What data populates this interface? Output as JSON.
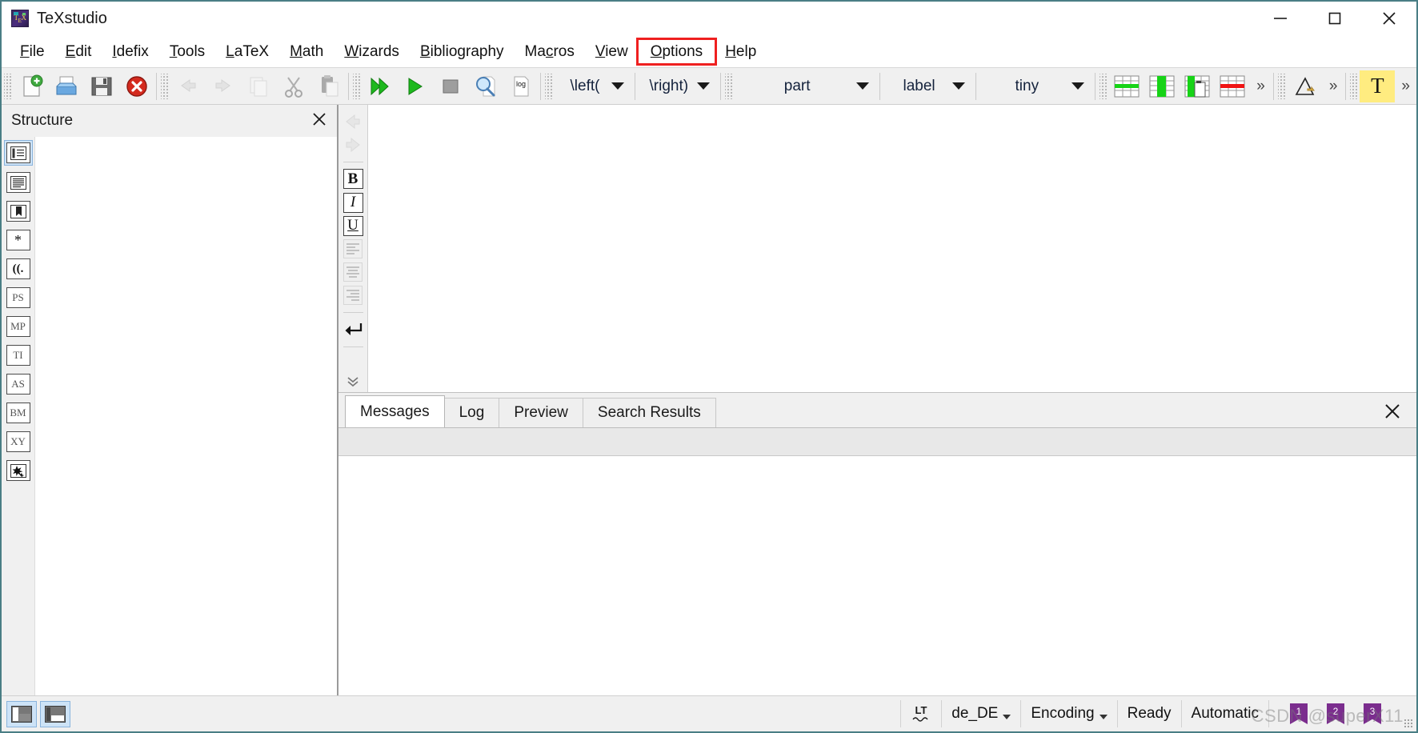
{
  "window": {
    "title": "TeXstudio",
    "icon": "texstudio-app-icon",
    "controls": {
      "minimize": "minimize-button",
      "maximize": "maximize-button",
      "close": "close-button"
    }
  },
  "menubar": {
    "items": [
      {
        "label": "File",
        "accel": "F",
        "highlighted": false
      },
      {
        "label": "Edit",
        "accel": "E",
        "highlighted": false
      },
      {
        "label": "Idefix",
        "accel": "I",
        "highlighted": false
      },
      {
        "label": "Tools",
        "accel": "T",
        "highlighted": false
      },
      {
        "label": "LaTeX",
        "accel": "L",
        "highlighted": false
      },
      {
        "label": "Math",
        "accel": "M",
        "highlighted": false
      },
      {
        "label": "Wizards",
        "accel": "W",
        "highlighted": false
      },
      {
        "label": "Bibliography",
        "accel": "B",
        "highlighted": false
      },
      {
        "label": "Macros",
        "accel": "c",
        "highlighted": false
      },
      {
        "label": "View",
        "accel": "V",
        "highlighted": false
      },
      {
        "label": "Options",
        "accel": "O",
        "highlighted": true
      },
      {
        "label": "Help",
        "accel": "H",
        "highlighted": false
      }
    ],
    "highlight_color": "#ef2020"
  },
  "toolbar": {
    "buttons": [
      {
        "name": "new-document-icon",
        "enabled": true
      },
      {
        "name": "open-document-icon",
        "enabled": true
      },
      {
        "name": "save-document-icon",
        "enabled": true
      },
      {
        "name": "close-document-icon",
        "enabled": true
      },
      {
        "name": "undo-icon",
        "enabled": false
      },
      {
        "name": "redo-icon",
        "enabled": false
      },
      {
        "name": "copy-icon",
        "enabled": false
      },
      {
        "name": "cut-scissors-icon",
        "enabled": false
      },
      {
        "name": "paste-clipboard-icon",
        "enabled": false
      },
      {
        "name": "build-and-view-icon",
        "enabled": true
      },
      {
        "name": "compile-run-icon",
        "enabled": true
      },
      {
        "name": "stop-compile-icon",
        "enabled": true
      },
      {
        "name": "view-pdf-icon",
        "enabled": true
      },
      {
        "name": "view-log-icon",
        "enabled": true
      }
    ],
    "combos": [
      {
        "name": "left-delimiter-combo",
        "value": "\\left("
      },
      {
        "name": "right-delimiter-combo",
        "value": "\\right)"
      },
      {
        "name": "section-level-combo",
        "value": "part"
      },
      {
        "name": "reference-type-combo",
        "value": "label"
      },
      {
        "name": "font-size-combo",
        "value": "tiny"
      }
    ],
    "table_buttons": [
      {
        "name": "insert-table-row-icon"
      },
      {
        "name": "insert-table-column-icon"
      },
      {
        "name": "paste-table-column-icon"
      },
      {
        "name": "delete-table-row-icon"
      }
    ],
    "overflow_label": "»",
    "math_button": {
      "name": "insert-graphic-icon"
    },
    "text_button": {
      "name": "highlight-text-icon",
      "label": "T",
      "color": "#ffec80"
    }
  },
  "structure_panel": {
    "title": "Structure",
    "close_button": "close-structure-panel",
    "icons": [
      {
        "name": "sidebar-structure-view",
        "glyph": "structure",
        "selected": true
      },
      {
        "name": "sidebar-document-view",
        "glyph": "lines",
        "selected": false
      },
      {
        "name": "sidebar-bookmarks-view",
        "glyph": "bookmark",
        "selected": false
      },
      {
        "name": "sidebar-symbols-misc",
        "glyph": "*",
        "selected": false
      },
      {
        "name": "sidebar-delimiters",
        "glyph": "((.",
        "selected": false
      },
      {
        "name": "sidebar-symbols-ps",
        "glyph": "PS",
        "selected": false
      },
      {
        "name": "sidebar-symbols-mp",
        "glyph": "MP",
        "selected": false
      },
      {
        "name": "sidebar-symbols-ti",
        "glyph": "TI",
        "selected": false
      },
      {
        "name": "sidebar-symbols-as",
        "glyph": "AS",
        "selected": false
      },
      {
        "name": "sidebar-symbols-bm",
        "glyph": "BM",
        "selected": false
      },
      {
        "name": "sidebar-symbols-xy",
        "glyph": "XY",
        "selected": false
      },
      {
        "name": "sidebar-symbols-star",
        "glyph": "star",
        "selected": false
      }
    ],
    "tree_items": []
  },
  "editor": {
    "vertical_toolbar": [
      {
        "name": "editor-back-icon",
        "enabled": false
      },
      {
        "name": "editor-forward-icon",
        "enabled": false
      },
      {
        "name": "bold-button",
        "label": "B",
        "enabled": true
      },
      {
        "name": "italic-button",
        "label": "I",
        "enabled": true
      },
      {
        "name": "underline-button",
        "label": "U",
        "enabled": true
      },
      {
        "name": "align-left-button",
        "enabled": false
      },
      {
        "name": "align-center-button",
        "enabled": false
      },
      {
        "name": "align-right-button",
        "enabled": false
      },
      {
        "name": "newline-button",
        "enabled": true
      },
      {
        "name": "expand-toolbar-button",
        "enabled": true
      }
    ],
    "content": ""
  },
  "output_panel": {
    "tabs": [
      {
        "label": "Messages",
        "active": true
      },
      {
        "label": "Log",
        "active": false
      },
      {
        "label": "Preview",
        "active": false
      },
      {
        "label": "Search Results",
        "active": false
      }
    ],
    "close_button": "close-output-panel",
    "content": ""
  },
  "statusbar": {
    "panel_toggles": [
      {
        "name": "toggle-structure-panel",
        "active": true
      },
      {
        "name": "toggle-output-panel",
        "active": true
      }
    ],
    "cells": [
      {
        "name": "language-tool-indicator",
        "label": "LT",
        "type": "icon",
        "dropdown": false
      },
      {
        "name": "spellcheck-language",
        "label": "de_DE",
        "type": "text",
        "dropdown": true
      },
      {
        "name": "encoding-selector",
        "label": "Encoding",
        "type": "text",
        "dropdown": true
      },
      {
        "name": "compile-status",
        "label": "Ready",
        "type": "text",
        "dropdown": false
      },
      {
        "name": "line-ending-mode",
        "label": "Automatic",
        "type": "text",
        "dropdown": false
      }
    ],
    "bookmarks": [
      {
        "name": "bookmark-slot-1",
        "label": "1"
      },
      {
        "name": "bookmark-slot-2",
        "label": "2"
      },
      {
        "name": "bookmark-slot-3",
        "label": "3"
      }
    ],
    "watermark": "CSDN @superX11"
  }
}
